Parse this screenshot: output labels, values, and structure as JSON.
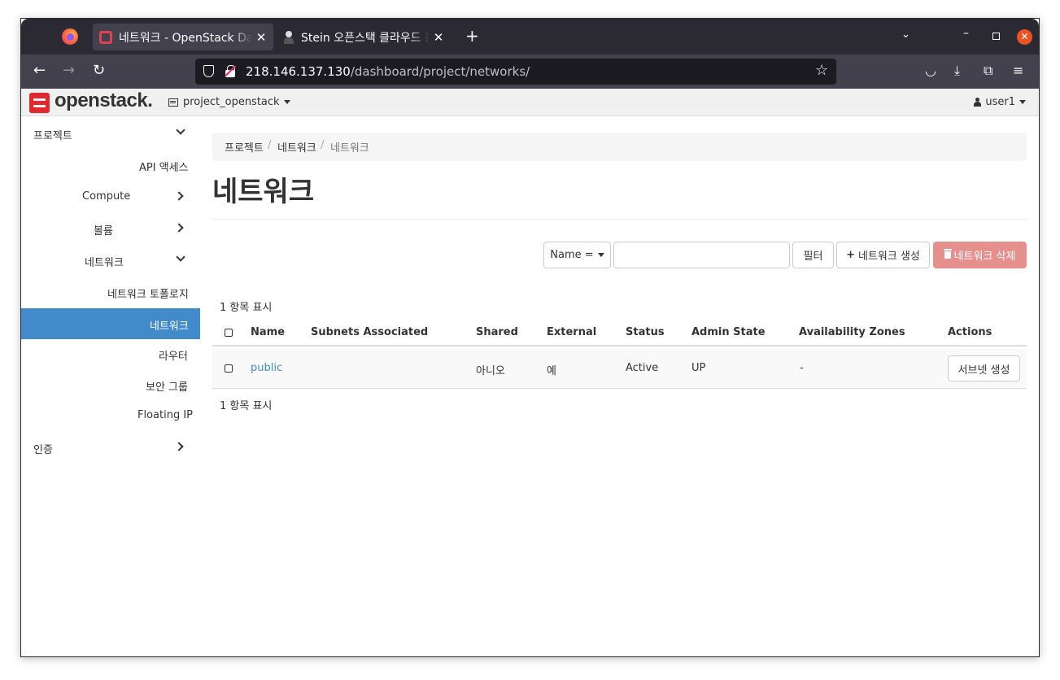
{
  "browser": {
    "tabs": [
      {
        "title": "네트워크 - OpenStack Dashboard",
        "active": true
      },
      {
        "title": "Stein 오픈스택 클라우드 분",
        "active": false
      }
    ],
    "url_host": "218.146.137.130",
    "url_path": "/dashboard/project/networks/",
    "icons": {
      "back": "←",
      "forward": "→",
      "reload": "↻",
      "star": "☆",
      "new_tab": "+",
      "tab_list": "⌄",
      "tab_close": "✕",
      "pocket": "◡",
      "download": "⤓",
      "extensions": "⧉",
      "menu": "≡",
      "win_min": "–",
      "win_close": "✕"
    }
  },
  "header": {
    "logo_text": "openstack.",
    "project": "project_openstack",
    "user": "user1"
  },
  "sidebar": {
    "items": [
      {
        "label": "프로젝트",
        "chevron": "down"
      },
      {
        "label": "API 액세스"
      },
      {
        "label": "Compute",
        "chevron": "right"
      },
      {
        "label": "볼륨",
        "chevron": "right"
      },
      {
        "label": "네트워크",
        "chevron": "down"
      },
      {
        "label": "네트워크 토폴로지"
      },
      {
        "label": "네트워크",
        "active": true
      },
      {
        "label": "라우터"
      },
      {
        "label": "보안 그룹"
      },
      {
        "label": "Floating IP"
      },
      {
        "label": "인증",
        "chevron": "right"
      }
    ]
  },
  "main": {
    "breadcrumb": [
      "프로젝트",
      "네트워크",
      "네트워크"
    ],
    "breadcrumb_sep": "/",
    "title": "네트워크",
    "filter": {
      "field": "Name =",
      "value": "",
      "filter_button": "필터",
      "create_button": "네트워크 생성",
      "delete_button": "네트워크 삭제",
      "create_icon": "+"
    },
    "count_top": "1 항목 표시",
    "count_bottom": "1 항목 표시",
    "table": {
      "columns": [
        "Name",
        "Subnets Associated",
        "Shared",
        "External",
        "Status",
        "Admin State",
        "Availability Zones",
        "Actions"
      ],
      "rows": [
        {
          "name": "public",
          "subnets": "",
          "shared": "아니오",
          "external": "예",
          "status": "Active",
          "admin_state": "UP",
          "zones": "-",
          "action": "서브넷 생성"
        }
      ]
    }
  },
  "colors": {
    "active_nav": "#428bca",
    "link": "#428bca",
    "danger_button": "#e6908e",
    "brand_red": "#e0282e"
  }
}
